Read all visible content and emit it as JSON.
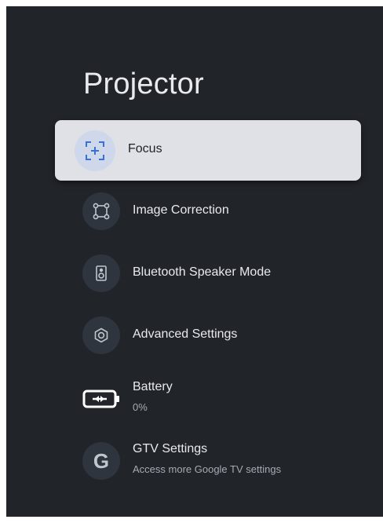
{
  "page": {
    "title": "Projector"
  },
  "menu": {
    "items": [
      {
        "label": "Focus",
        "icon": "focus-icon",
        "focused": true
      },
      {
        "label": "Image Correction",
        "icon": "image-correction-icon"
      },
      {
        "label": "Bluetooth Speaker Mode",
        "icon": "speaker-icon"
      },
      {
        "label": "Advanced Settings",
        "icon": "gear-icon"
      },
      {
        "label": "Battery",
        "sublabel": "0%",
        "icon": "battery-charging-icon"
      },
      {
        "label": "GTV Settings",
        "sublabel": "Access more Google TV settings",
        "icon": "google-icon",
        "icon_glyph": "G"
      }
    ]
  },
  "colors": {
    "panel_bg": "#212429",
    "focus_bg": "#dfe1e6",
    "focus_icon": "#3b6fd8",
    "text_primary": "#e8eaed",
    "text_secondary": "#a6abb3"
  }
}
